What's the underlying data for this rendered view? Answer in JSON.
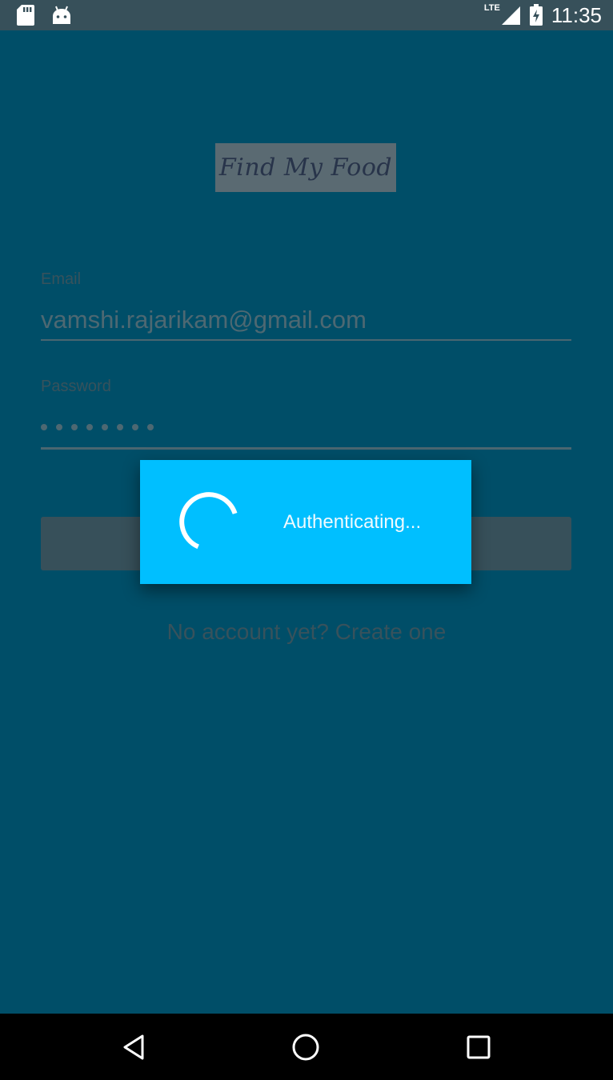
{
  "status_bar": {
    "time": "11:35",
    "network": "LTE",
    "left_icons": [
      "sd-card-icon",
      "android-debug-icon"
    ],
    "right_icons": [
      "signal-icon",
      "battery-charging-icon"
    ]
  },
  "app": {
    "logo_text": "Find My Food",
    "email": {
      "label": "Email",
      "value": "vamshi.rajarikam@gmail.com"
    },
    "password": {
      "label": "Password",
      "masked_length": 8
    },
    "login_button_label": "",
    "signup_link": "No account yet? Create one"
  },
  "dialog": {
    "message": "Authenticating..."
  },
  "nav_bar": {
    "buttons": [
      "back-icon",
      "home-icon",
      "recents-icon"
    ]
  },
  "colors": {
    "background": "#004e68",
    "status_bar": "#37505a",
    "dialog": "#00bfff"
  }
}
